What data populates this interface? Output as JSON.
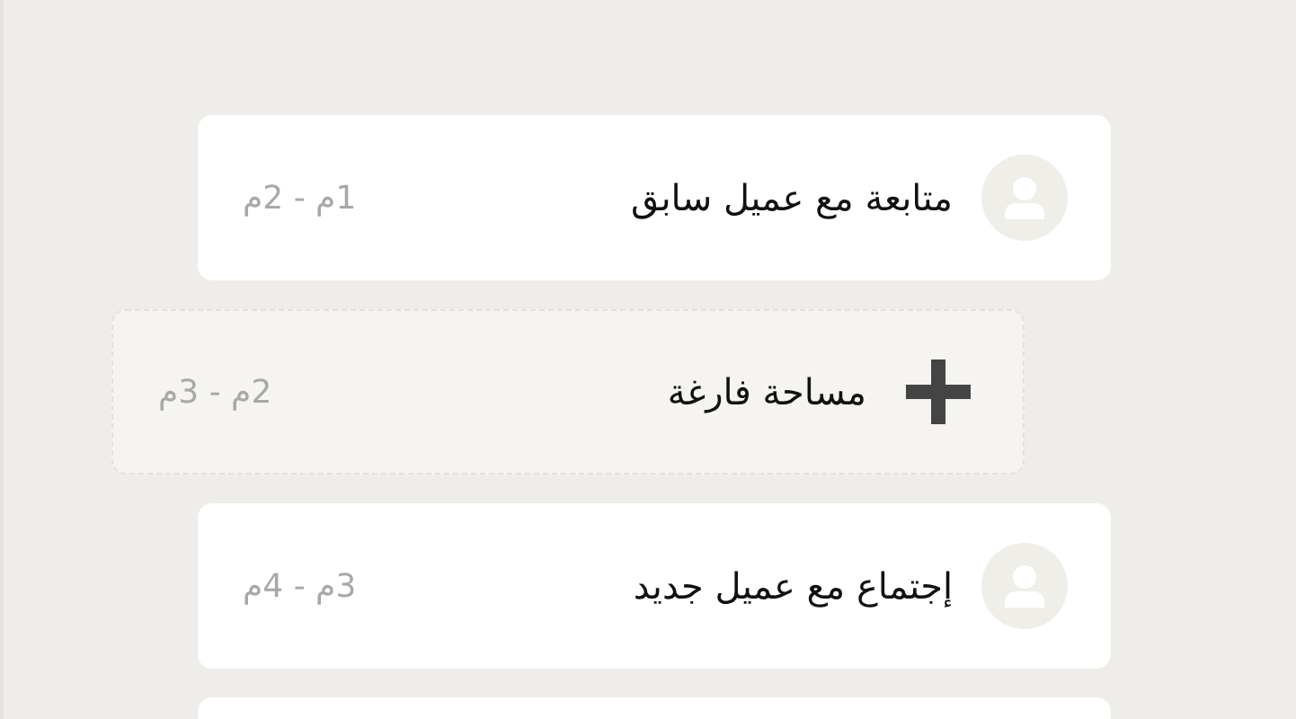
{
  "schedule": [
    {
      "kind": "appointment",
      "title": "متابعة مع عميل سابق",
      "time": "1م - 2م"
    },
    {
      "kind": "empty_slot",
      "title": "مساحة فارغة",
      "time": "2م - 3م"
    },
    {
      "kind": "appointment",
      "title": "إجتماع مع عميل جديد",
      "time": "3م - 4م"
    }
  ]
}
